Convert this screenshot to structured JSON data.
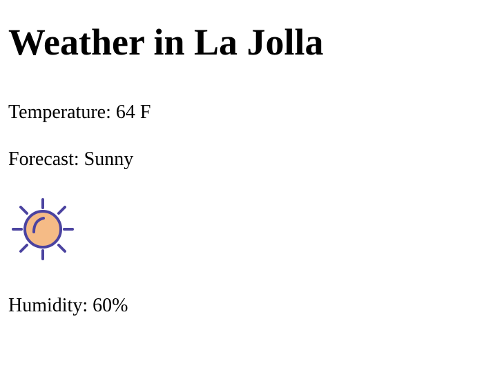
{
  "page": {
    "title": "Weather in La Jolla",
    "temperature_text": "Temperature: 64 F",
    "forecast_text": "Forecast: Sunny",
    "humidity_text": "Humidity: 60%"
  },
  "icon": {
    "name": "sun-icon",
    "stroke_color": "#4b43a0",
    "fill_color": "#f5bb86"
  }
}
